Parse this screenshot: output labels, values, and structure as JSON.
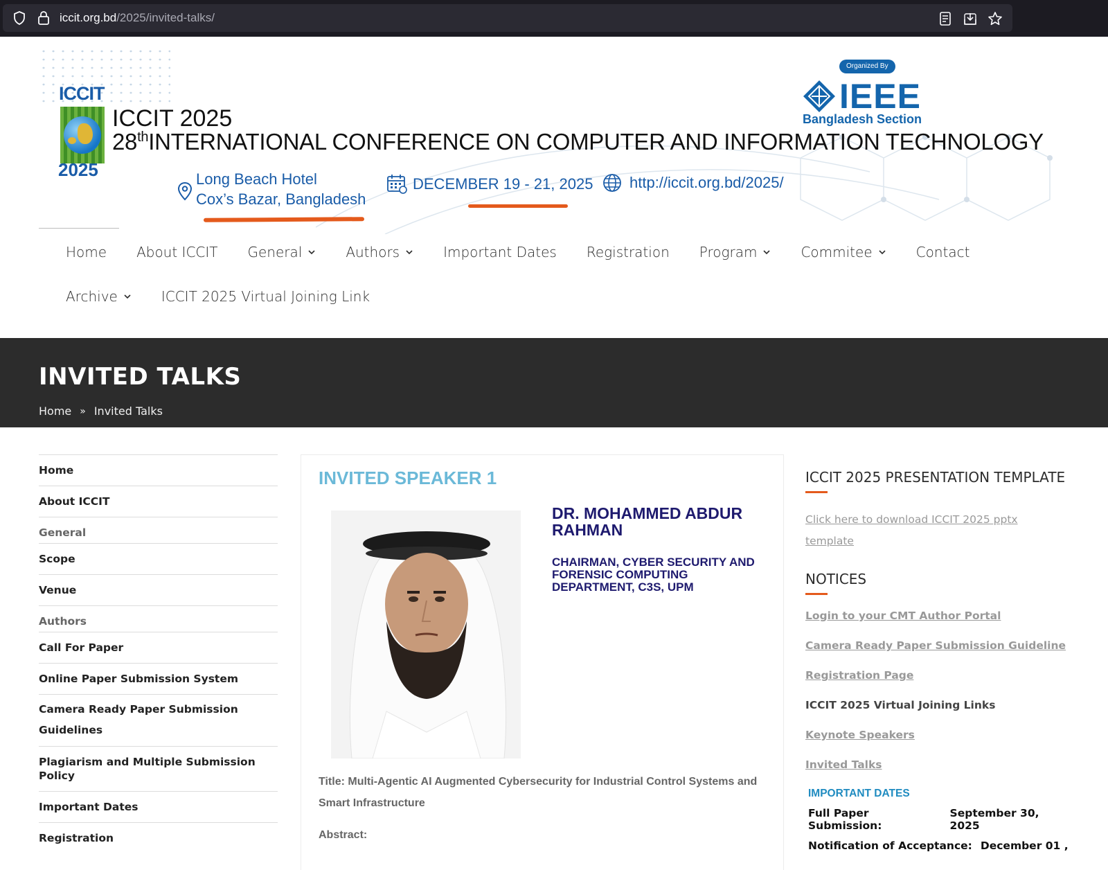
{
  "browser": {
    "url_host": "iccit.org.bd",
    "url_path": "/2025/invited-talks/"
  },
  "header": {
    "logo_word": "ICCIT",
    "logo_year": "2025",
    "conf_short": "ICCIT 2025",
    "conf_ordinal": "28",
    "conf_ordinal_suffix": "th",
    "conf_name": "INTERNATIONAL CONFERENCE ON COMPUTER AND INFORMATION TECHNOLOGY",
    "organized_by": "Organized By",
    "ieee": "IEEE",
    "ieee_sub": "Bangladesh Section",
    "venue_line1": "Long Beach Hotel",
    "venue_line2": "Cox’s Bazar, Bangladesh",
    "dates": "DECEMBER 19 - 21, 2025",
    "website": "http://iccit.org.bd/2025/",
    "accent_color": "#1a5ca8",
    "underline_color": "#e45a1c"
  },
  "nav": {
    "row1": [
      {
        "label": "Home",
        "dropdown": false
      },
      {
        "label": "About ICCIT",
        "dropdown": false
      },
      {
        "label": "General",
        "dropdown": true
      },
      {
        "label": "Authors",
        "dropdown": true
      },
      {
        "label": "Important Dates",
        "dropdown": false
      },
      {
        "label": "Registration",
        "dropdown": false
      },
      {
        "label": "Program",
        "dropdown": true
      },
      {
        "label": "Commitee",
        "dropdown": true
      },
      {
        "label": "Contact",
        "dropdown": false
      }
    ],
    "row2": [
      {
        "label": "Archive",
        "dropdown": true
      },
      {
        "label": "ICCIT 2025 Virtual Joining Link",
        "dropdown": false
      }
    ]
  },
  "banner": {
    "title": "INVITED TALKS",
    "crumb_home": "Home",
    "crumb_sep": "»",
    "crumb_current": "Invited Talks"
  },
  "leftnav": [
    {
      "type": "item",
      "label": "Home"
    },
    {
      "type": "item",
      "label": "About ICCIT"
    },
    {
      "type": "group",
      "label": "General"
    },
    {
      "type": "item",
      "label": "Scope"
    },
    {
      "type": "item",
      "label": "Venue"
    },
    {
      "type": "group",
      "label": "Authors"
    },
    {
      "type": "item",
      "label": "Call For Paper"
    },
    {
      "type": "item",
      "label": "Online Paper Submission System"
    },
    {
      "type": "item",
      "label": "Camera Ready Paper Submission Guidelines"
    },
    {
      "type": "item",
      "label": "Plagiarism and Multiple Submission Policy"
    },
    {
      "type": "item",
      "label": "Important Dates"
    },
    {
      "type": "item",
      "label": "Registration"
    }
  ],
  "speaker": {
    "heading": "INVITED SPEAKER 1",
    "name": "DR. MOHAMMED ABDUR RAHMAN",
    "role": "CHAIRMAN, CYBER SECURITY AND FORENSIC COMPUTING DEPARTMENT, C3S, UPM",
    "talk_title": "Title: Multi-Agentic AI Augmented Cybersecurity for Industrial Control Systems and Smart Infrastructure",
    "abstract_label": "Abstract:",
    "heading_color": "#6bb9d8",
    "name_color": "#1e1a6e"
  },
  "rightbar": {
    "template_heading": "ICCIT 2025 PRESENTATION TEMPLATE",
    "template_link": "Click here to download ICCIT 2025 pptx template",
    "notices_heading": "NOTICES",
    "notices": [
      {
        "label": "Login to your CMT Author Portal",
        "link": true
      },
      {
        "label": "Camera Ready Paper Submission Guideline",
        "link": true
      },
      {
        "label": "Registration Page",
        "link": true
      },
      {
        "label": "ICCIT 2025 Virtual Joining Links",
        "link": false
      },
      {
        "label": "Keynote Speakers",
        "link": true
      },
      {
        "label": "Invited Talks",
        "link": true
      }
    ],
    "important_heading": "IMPORTANT DATES",
    "dates": [
      {
        "key": "Full Paper Submission:",
        "value": "September 30, 2025"
      },
      {
        "key": "Notification of Acceptance:",
        "value": "December 01 ,"
      }
    ],
    "accent_color": "#e45a1c"
  }
}
